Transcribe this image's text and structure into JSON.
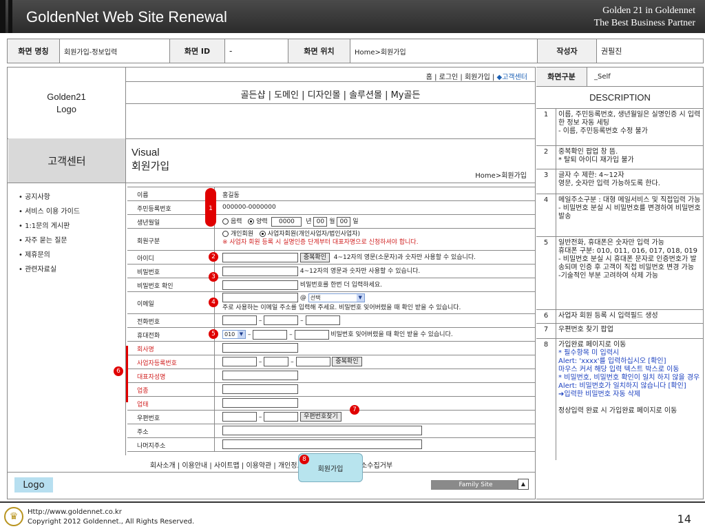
{
  "header": {
    "title": "GoldenNet Web Site Renewal",
    "right_line1": "Golden 21 in Goldennet",
    "right_line2": "The Best Business Partner"
  },
  "info": {
    "screen_name_label": "화면 명칭",
    "screen_name": "회원가입-정보입력",
    "screen_id_label": "화면 ID",
    "screen_id": "-",
    "location_label": "화면 위치",
    "location": "Home>회원가입",
    "author_label": "작성자",
    "author": "권필진",
    "type_label": "화면구분",
    "type": "_Self"
  },
  "site": {
    "logo": "Golden21\nLogo",
    "top_nav_left": "홈 | 로그인 | 회원가입 | ",
    "top_nav_hl": "◆고객센터",
    "main_nav": "골든샵 | 도메인 | 디자인몰 | 솔루션몰 | My골든",
    "section": "고객센터",
    "visual1": "Visual",
    "visual2": "회원가입",
    "crumb": "Home>회원가입",
    "side_menu": [
      "• 공지사항",
      "• 서비스 이용 가이드",
      "• 1:1문의 게시판",
      "• 자주 묻는 질문",
      "• 제휴문의",
      "• 관련자료실"
    ]
  },
  "form": {
    "name_label": "이름",
    "name_value": "홍길동",
    "ssn_label": "주민등록번호",
    "ssn_value": "000000-0000000",
    "birth_label": "생년월일",
    "lunar": "음력",
    "solar": "양력",
    "year": "0000",
    "year_unit": "년",
    "month": "00",
    "month_unit": "월",
    "day": "00",
    "day_unit": "일",
    "type_label": "회원구분",
    "personal": "개인회원",
    "business": "사업자회원(개인사업자/법인사업자)",
    "business_note": "※ 사업자 회원 등록 시 실명인증 단계부터 대표자명으로 신청하셔야 합니다.",
    "id_label": "아이디",
    "dup_button": "중복확인",
    "id_hint": "4~12자의 영문(소문자)과 숫자만 사용할 수 있습니다.",
    "pw_label": "비밀번호",
    "pw_hint": "4~12자의 영문과 숫자만 사용할 수 있습니다.",
    "pw2_label": "비밀번호 확인",
    "pw2_hint": "비밀번호를 한번 더 입력하세요.",
    "email_label": "이메일",
    "at": "@",
    "email_select": "선택",
    "email_hint": "주로 사용하는 이메일 주소를 입력해 주세요. 비밀번호 잊어버렸을 때 확인 받을 수 있습니다.",
    "phone_label": "전화번호",
    "mobile_label": "휴대전화",
    "mobile_prefix": "010",
    "mobile_hint": "비밀번호 잊어버렸을 때 확인 받을 수 있습니다.",
    "company_label": "회사명",
    "bizno_label": "사업자등록번호",
    "bizno_button": "중복확인",
    "ceo_label": "대표자성명",
    "industry_label": "업종",
    "category_label": "업태",
    "zip_label": "우편번호",
    "zip_button": "우편번호찾기",
    "addr_label": "주소",
    "addr2_label": "나머지주소",
    "dash": "–"
  },
  "footer": {
    "links": "회사소개 | 이용안내 | 사이트맵 | 이용약관 | 개인정보취급방침 | 이메일주소수집거부",
    "popup": "회원가입",
    "logo": "Logo",
    "family": "Family Site",
    "family_btn": "▲"
  },
  "markers": [
    "1",
    "2",
    "3",
    "4",
    "5",
    "6",
    "7",
    "8"
  ],
  "description": {
    "title": "DESCRIPTION",
    "items": [
      {
        "num": "1",
        "text": "이름, 주민등록번호, 생년월일은 실명인증 시 입력한 정보 자동 세팅\n- 이름, 주민등록번호 수정 불가"
      },
      {
        "num": "2",
        "text": "중복확인 팝업 창 뜸.\n* 탈퇴 아이디 재가입 불가"
      },
      {
        "num": "3",
        "text": "글자 수 제한: 4~12자\n영문, 숫자만 입력 가능하도록 한다."
      },
      {
        "num": "4",
        "text": "메일주소구분 : 대형 메일서비스 및 직접입력 가능\n- 비밀번호 분실 시 비밀번호를 변경하여 비밀번호 발송"
      },
      {
        "num": "5",
        "text": "일반전화, 휴대폰은 숫자만 입력 가능\n휴대폰 구분: 010, 011, 016, 017, 018, 019\n- 비밀번호 분실 시 휴대폰 문자로 인증번호가 발송되며 인증 후 고객이 직접 비밀번호 변경 가능\n-기술적인 부분 고려하여 삭제 가능"
      },
      {
        "num": "6",
        "text": "사업자 회원 등록 시 입력필드 생성"
      },
      {
        "num": "7",
        "text": "우편번호 찾기 팝업"
      },
      {
        "num": "8",
        "text": "가입완료 페이지로 이동"
      }
    ],
    "item8_blue": "* 필수항목 미 입력시\nAlert: 'xxxx'를 입력하십시오 [확인]\n마우스 커서 해당 입력 텍스트 박스로 이동\n* 비밀번호, 비밀번호 확인이 일치 하지 않을 경우\nAlert: 비밀번호가 일치하지 않습니다 [확인]\n➔입력한 비밀번호 자동 삭제",
    "item8_tail": "정상입력 완료 시 가입완료 페이지로 이동"
  },
  "bottom": {
    "url": "Http://www.goldennet.co.kr",
    "copyright": "Copyright 2012 Goldennet., All Rights Reserved.",
    "page": "14"
  }
}
